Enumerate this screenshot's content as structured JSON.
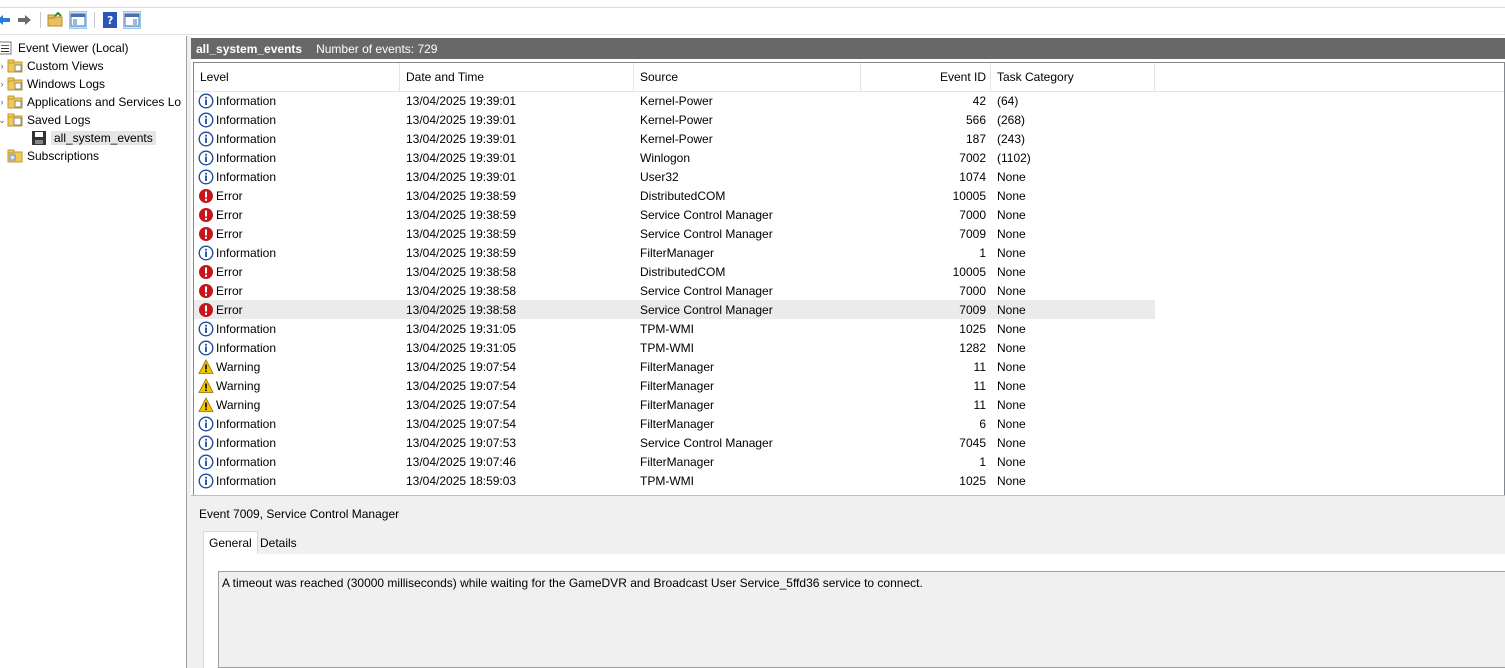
{
  "tree": {
    "root": "Event Viewer (Local)",
    "items": [
      {
        "label": "Custom Views",
        "expander": "›"
      },
      {
        "label": "Windows Logs",
        "expander": "›"
      },
      {
        "label": "Applications and Services Lo",
        "expander": "›"
      },
      {
        "label": "Saved Logs",
        "expander": "⌄"
      },
      {
        "label": "all_system_events",
        "expander": ""
      },
      {
        "label": "Subscriptions",
        "expander": ""
      }
    ]
  },
  "log_header": {
    "name": "all_system_events",
    "count": "Number of events: 729"
  },
  "columns": [
    "Level",
    "Date and Time",
    "Source",
    "Event ID",
    "Task Category"
  ],
  "events": [
    {
      "level": "Information",
      "date": "13/04/2025 19:39:01",
      "source": "Kernel-Power",
      "id": "42",
      "category": "(64)"
    },
    {
      "level": "Information",
      "date": "13/04/2025 19:39:01",
      "source": "Kernel-Power",
      "id": "566",
      "category": "(268)"
    },
    {
      "level": "Information",
      "date": "13/04/2025 19:39:01",
      "source": "Kernel-Power",
      "id": "187",
      "category": "(243)"
    },
    {
      "level": "Information",
      "date": "13/04/2025 19:39:01",
      "source": "Winlogon",
      "id": "7002",
      "category": "(1102)"
    },
    {
      "level": "Information",
      "date": "13/04/2025 19:39:01",
      "source": "User32",
      "id": "1074",
      "category": "None"
    },
    {
      "level": "Error",
      "date": "13/04/2025 19:38:59",
      "source": "DistributedCOM",
      "id": "10005",
      "category": "None"
    },
    {
      "level": "Error",
      "date": "13/04/2025 19:38:59",
      "source": "Service Control Manager",
      "id": "7000",
      "category": "None"
    },
    {
      "level": "Error",
      "date": "13/04/2025 19:38:59",
      "source": "Service Control Manager",
      "id": "7009",
      "category": "None"
    },
    {
      "level": "Information",
      "date": "13/04/2025 19:38:59",
      "source": "FilterManager",
      "id": "1",
      "category": "None"
    },
    {
      "level": "Error",
      "date": "13/04/2025 19:38:58",
      "source": "DistributedCOM",
      "id": "10005",
      "category": "None"
    },
    {
      "level": "Error",
      "date": "13/04/2025 19:38:58",
      "source": "Service Control Manager",
      "id": "7000",
      "category": "None"
    },
    {
      "level": "Error",
      "date": "13/04/2025 19:38:58",
      "source": "Service Control Manager",
      "id": "7009",
      "category": "None",
      "selected": true
    },
    {
      "level": "Information",
      "date": "13/04/2025 19:31:05",
      "source": "TPM-WMI",
      "id": "1025",
      "category": "None"
    },
    {
      "level": "Information",
      "date": "13/04/2025 19:31:05",
      "source": "TPM-WMI",
      "id": "1282",
      "category": "None"
    },
    {
      "level": "Warning",
      "date": "13/04/2025 19:07:54",
      "source": "FilterManager",
      "id": "11",
      "category": "None"
    },
    {
      "level": "Warning",
      "date": "13/04/2025 19:07:54",
      "source": "FilterManager",
      "id": "11",
      "category": "None"
    },
    {
      "level": "Warning",
      "date": "13/04/2025 19:07:54",
      "source": "FilterManager",
      "id": "11",
      "category": "None"
    },
    {
      "level": "Information",
      "date": "13/04/2025 19:07:54",
      "source": "FilterManager",
      "id": "6",
      "category": "None"
    },
    {
      "level": "Information",
      "date": "13/04/2025 19:07:53",
      "source": "Service Control Manager",
      "id": "7045",
      "category": "None"
    },
    {
      "level": "Information",
      "date": "13/04/2025 19:07:46",
      "source": "FilterManager",
      "id": "1",
      "category": "None"
    },
    {
      "level": "Information",
      "date": "13/04/2025 18:59:03",
      "source": "TPM-WMI",
      "id": "1025",
      "category": "None"
    }
  ],
  "detail": {
    "title": "Event 7009, Service Control Manager",
    "tabs": [
      "General",
      "Details"
    ],
    "message": "A timeout was reached (30000 milliseconds) while waiting for the GameDVR and Broadcast User Service_5ffd36 service to connect."
  },
  "colors": {
    "header_bg": "#686868",
    "info": "#1f4e9c",
    "error": "#c4161c",
    "warning": "#f5c400"
  }
}
